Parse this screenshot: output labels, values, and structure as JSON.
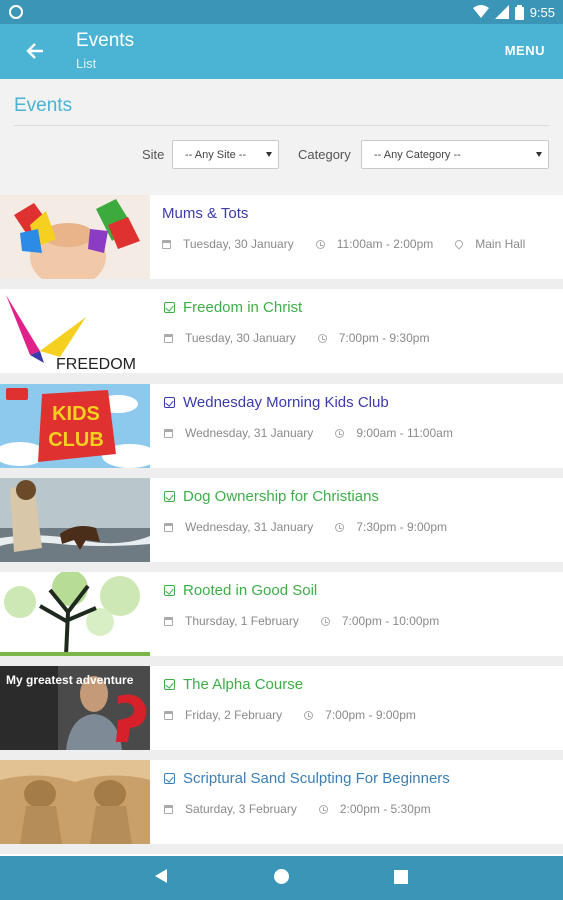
{
  "status_bar": {
    "time": "9:55"
  },
  "app_bar": {
    "title": "Events",
    "subtitle": "List",
    "menu_label": "MENU"
  },
  "filters": {
    "heading": "Events",
    "site_label": "Site",
    "site_value": "-- Any Site --",
    "category_label": "Category",
    "category_value": "-- Any Category --"
  },
  "events": [
    {
      "title": "Mums & Tots",
      "date": "Tuesday, 30 January",
      "time": "11:00am - 2:00pm",
      "location": "Main Hall",
      "checked": false,
      "title_color": "#3b3bab"
    },
    {
      "title": "Freedom in Christ",
      "date": "Tuesday, 30 January",
      "time": "7:00pm - 9:30pm",
      "location": "",
      "checked": true,
      "title_color": "#3fae49",
      "thumb_text": "FREEDOM"
    },
    {
      "title": "Wednesday Morning Kids Club",
      "date": "Wednesday, 31 January",
      "time": "9:00am - 11:00am",
      "location": "",
      "checked": true,
      "title_color": "#3b3bab",
      "thumb_text": "KIDS CLUB"
    },
    {
      "title": "Dog Ownership for Christians",
      "date": "Wednesday, 31 January",
      "time": "7:30pm - 9:00pm",
      "location": "",
      "checked": true,
      "title_color": "#3fae49"
    },
    {
      "title": "Rooted in Good Soil",
      "date": "Thursday, 1 February",
      "time": "7:00pm - 10:00pm",
      "location": "",
      "checked": true,
      "title_color": "#3fae49"
    },
    {
      "title": "The Alpha Course",
      "date": "Friday, 2 February",
      "time": "7:00pm - 9:00pm",
      "location": "",
      "checked": true,
      "title_color": "#3fae49",
      "thumb_text": "My greatest adventure"
    },
    {
      "title": "Scriptural Sand Sculpting For Beginners",
      "date": "Saturday, 3 February",
      "time": "2:00pm - 5:30pm",
      "location": "",
      "checked": true,
      "title_color": "#3b7fb8"
    }
  ],
  "colors": {
    "app_bar": "#4bb3d4",
    "status_bar": "#3a95b6",
    "accent": "#4bb3d4"
  }
}
